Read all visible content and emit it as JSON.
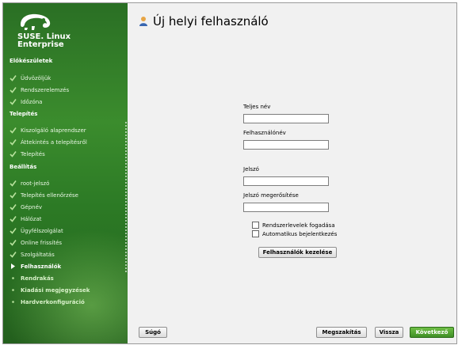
{
  "brand": {
    "line1": "SUSE. Linux",
    "line2": "Enterprise"
  },
  "sidebar": {
    "sections": [
      {
        "title": "Előkészületek",
        "steps": [
          {
            "label": "Üdvözöljük",
            "state": "done"
          },
          {
            "label": "Rendszerelemzés",
            "state": "done"
          },
          {
            "label": "Időzóna",
            "state": "done"
          }
        ]
      },
      {
        "title": "Telepítés",
        "steps": [
          {
            "label": "Kiszolgáló alaprendszer",
            "state": "done"
          },
          {
            "label": "Áttekintés a telepítésről",
            "state": "done"
          },
          {
            "label": "Telepítés",
            "state": "done"
          }
        ]
      },
      {
        "title": "Beállítás",
        "steps": [
          {
            "label": "root-jelszó",
            "state": "done"
          },
          {
            "label": "Telepítés ellenőrzése",
            "state": "done"
          },
          {
            "label": "Gépnév",
            "state": "done"
          },
          {
            "label": "Hálózat",
            "state": "done"
          },
          {
            "label": "Ügyfélszolgálat",
            "state": "done"
          },
          {
            "label": "Online frissítés",
            "state": "done"
          },
          {
            "label": "Szolgáltatás",
            "state": "done"
          },
          {
            "label": "Felhasználók",
            "state": "current"
          },
          {
            "label": "Rendrakás",
            "state": "future"
          },
          {
            "label": "Kiadási megjegyzések",
            "state": "future"
          },
          {
            "label": "Hardverkonfiguráció",
            "state": "future"
          }
        ]
      }
    ]
  },
  "page": {
    "title": "Új helyi felhasználó",
    "fields": {
      "full_name_label": "Teljes név",
      "full_name_value": "",
      "username_label": "Felhasználónév",
      "username_value": "",
      "password_label": "Jelszó",
      "password_value": "",
      "password_confirm_label": "Jelszó megerősítése",
      "password_confirm_value": ""
    },
    "checkboxes": {
      "receive_mail": "Rendszerlevelek fogadása",
      "auto_login": "Automatikus bejelentkezés"
    },
    "manage_users_button": "Felhasználók kezelése"
  },
  "footer": {
    "help": "Súgó",
    "abort": "Megszakítás",
    "back": "Vissza",
    "next": "Következő"
  },
  "colors": {
    "sidebar_green": "#2c7a25",
    "primary_button": "#4fa02f"
  }
}
